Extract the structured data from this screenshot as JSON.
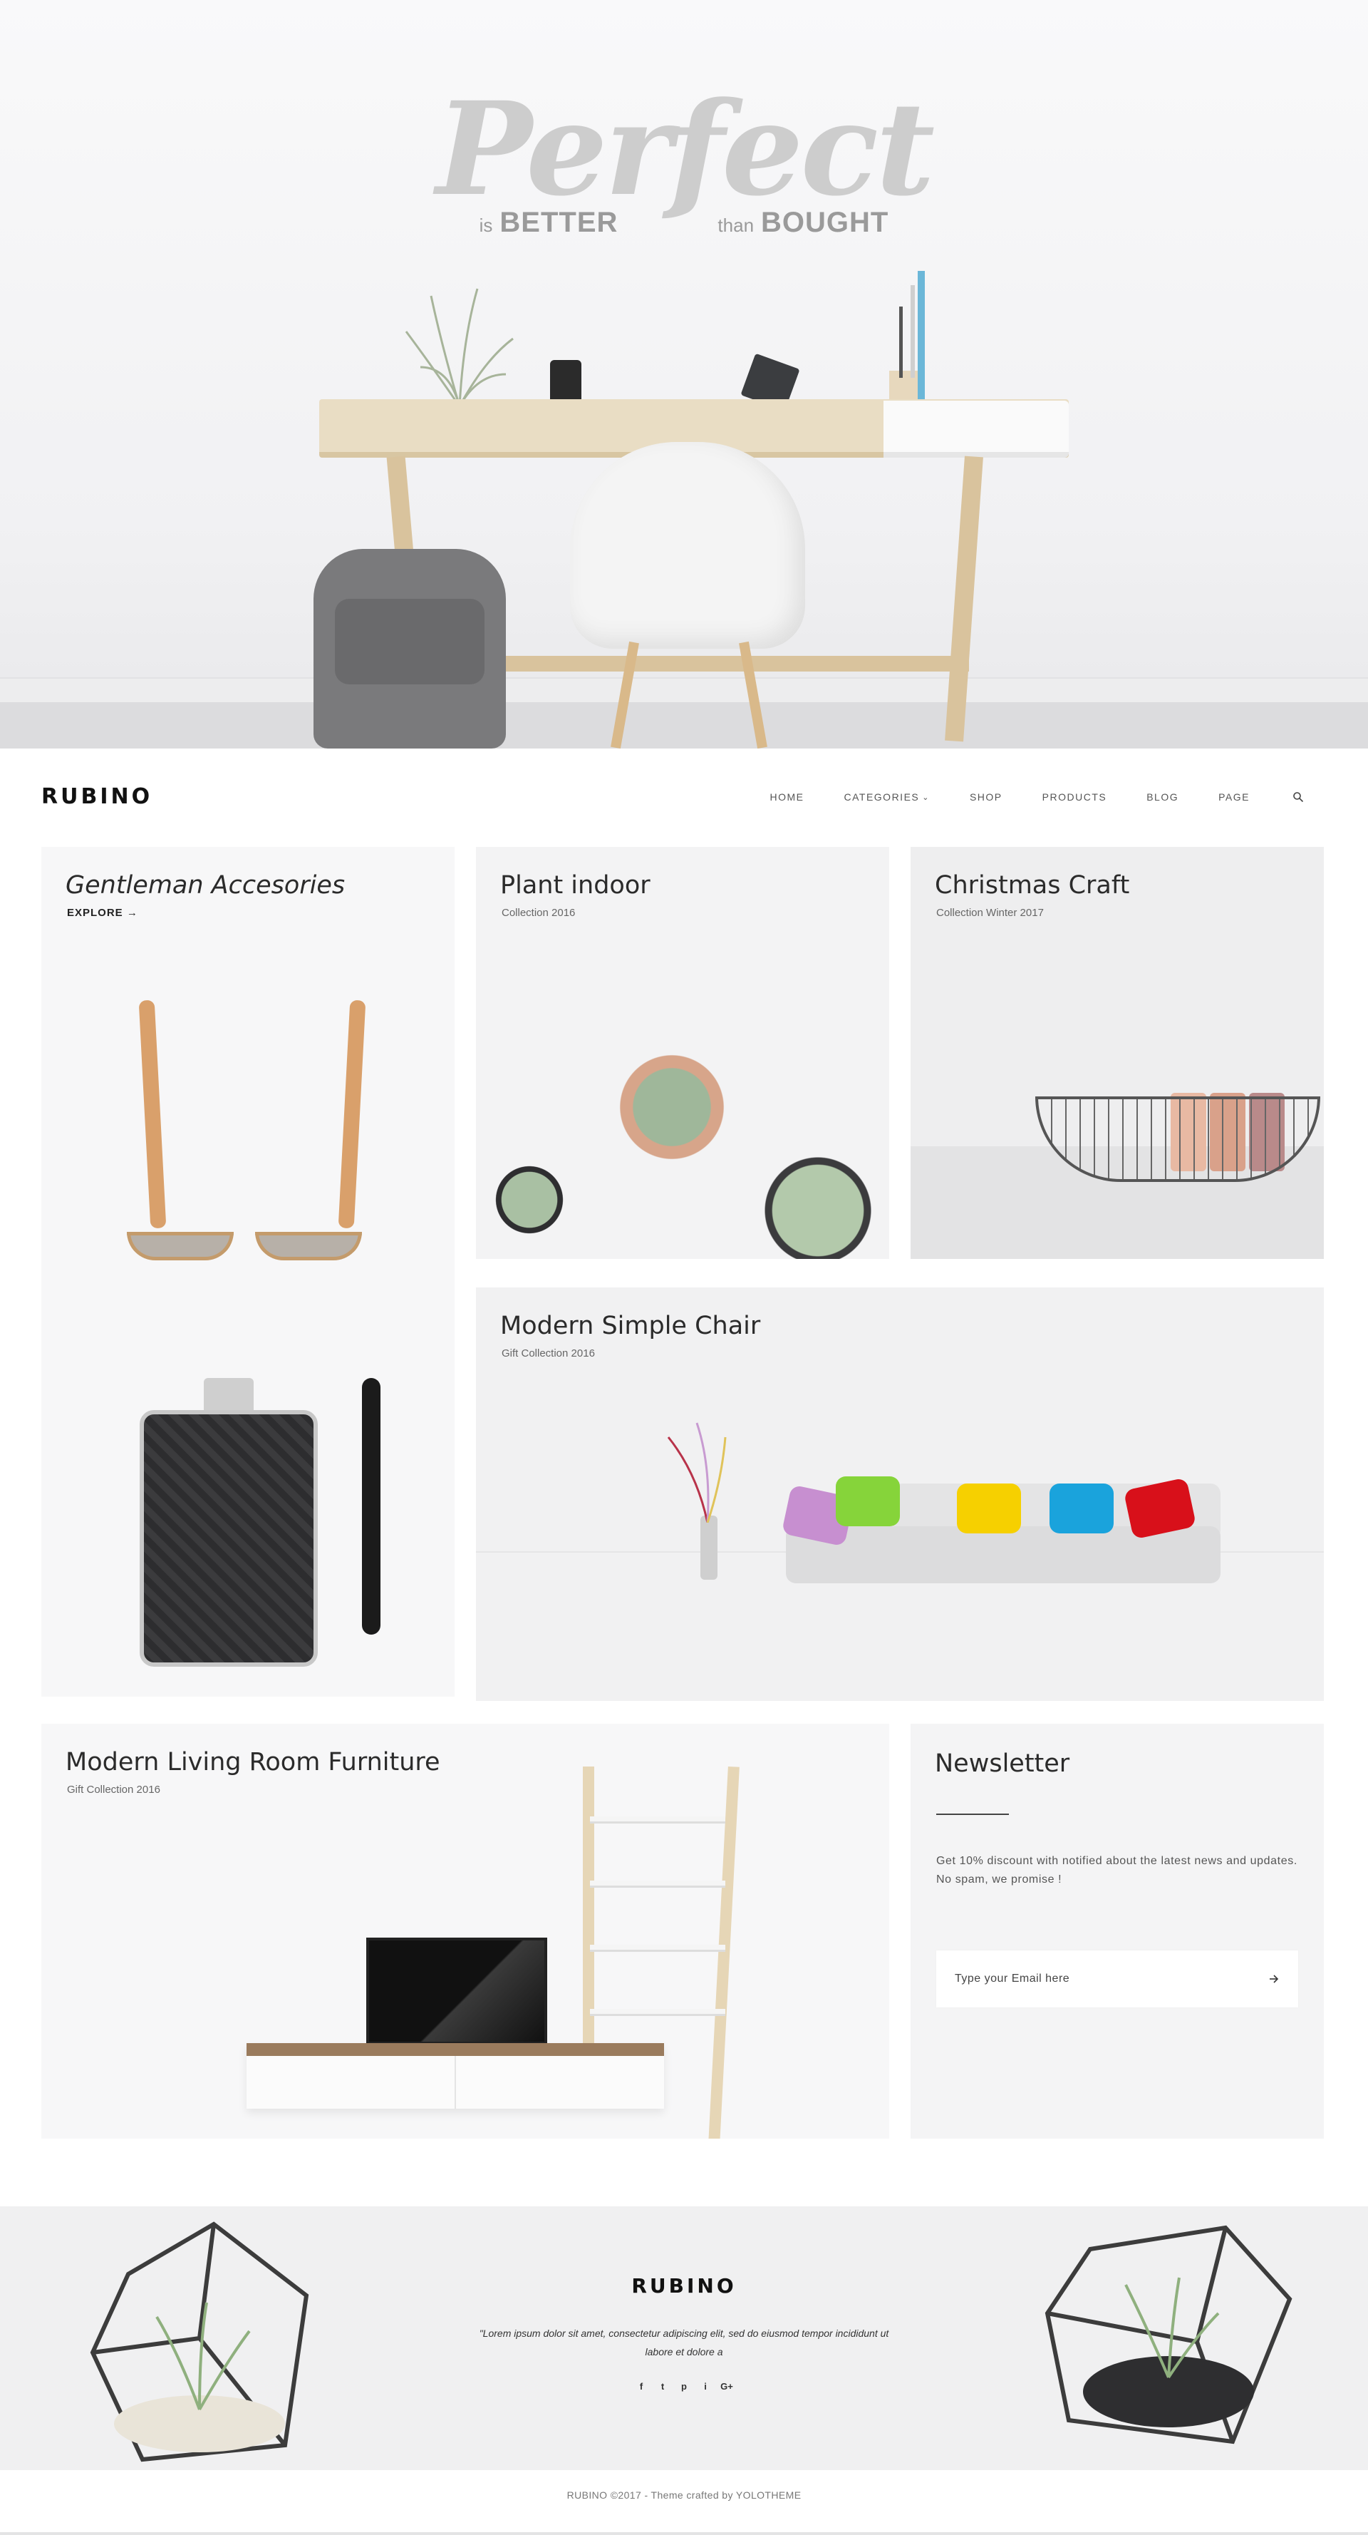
{
  "hero": {
    "script": "Perfect",
    "is": "is",
    "better": "BETTER",
    "than": "than",
    "bought": "BOUGHT"
  },
  "header": {
    "logo": "RUBINO",
    "nav": [
      "HOME",
      "CATEGORIES",
      "SHOP",
      "PRODUCTS",
      "BLOG",
      "PAGE"
    ]
  },
  "cards": {
    "gentleman": {
      "title": "Gentleman Accesories",
      "cta": "EXPLORE"
    },
    "plant": {
      "title": "Plant indoor",
      "subtitle": "Collection 2016"
    },
    "christmas": {
      "title": "Christmas Craft",
      "subtitle": "Collection Winter 2017"
    },
    "chair": {
      "title": "Modern Simple Chair",
      "subtitle": "Gift Collection 2016"
    },
    "living": {
      "title": "Modern Living Room Furniture",
      "subtitle": "Gift Collection 2016"
    }
  },
  "newsletter": {
    "title": "Newsletter",
    "text1": "Get 10% discount with notified about the latest news and updates.",
    "text2": "No spam, we promise !",
    "placeholder": "Type your Email here"
  },
  "footer": {
    "logo": "RUBINO",
    "text": "\"Lorem ipsum dolor sit amet, consectetur adipiscing elit, sed do eiusmod tempor incididunt ut labore et dolore a",
    "social": [
      "f",
      "t",
      "p",
      "i",
      "G+"
    ],
    "copyright": "RUBINO ©2017 - Theme crafted by YOLOTHEME"
  },
  "colors": {
    "background": "#ffffff",
    "card": "#f4f4f5",
    "footer": "#f0f0f1",
    "text": "#222222"
  }
}
